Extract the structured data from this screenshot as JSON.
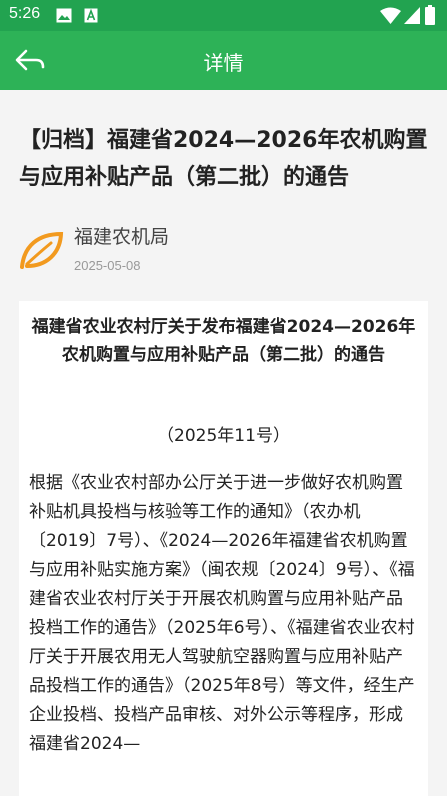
{
  "status_bar": {
    "time": "5:26"
  },
  "app_bar": {
    "title": "详情"
  },
  "article": {
    "title": "【归档】福建省2024—2026年农机购置与应用补贴产品（第二批）的通告",
    "source_name": "福建农机局",
    "date": "2025-05-08"
  },
  "content": {
    "doc_title": "福建省农业农村厅关于发布福建省2024—2026年农机购置与应用补贴产品（第二批）的通告",
    "doc_number": "（2025年11号）",
    "body": "根据《农业农村部办公厅关于进一步做好农机购置补贴机具投档与核验等工作的通知》（农办机〔2019〕7号）、《2024—2026年福建省农机购置与应用补贴实施方案》（闽农规〔2024〕9号）、《福建省农业农村厅关于开展农机购置与应用补贴产品投档工作的通告》（2025年6号）、《福建省农业农村厅关于开展农用无人驾驶航空器购置与应用补贴产品投档工作的通告》（2025年8号）等文件，经生产企业投档、投档产品审核、对外公示等程序，形成福建省2024—"
  },
  "colors": {
    "status_bar": "#22a350",
    "app_bar": "#2db257",
    "logo_orange": "#f29a1f"
  }
}
